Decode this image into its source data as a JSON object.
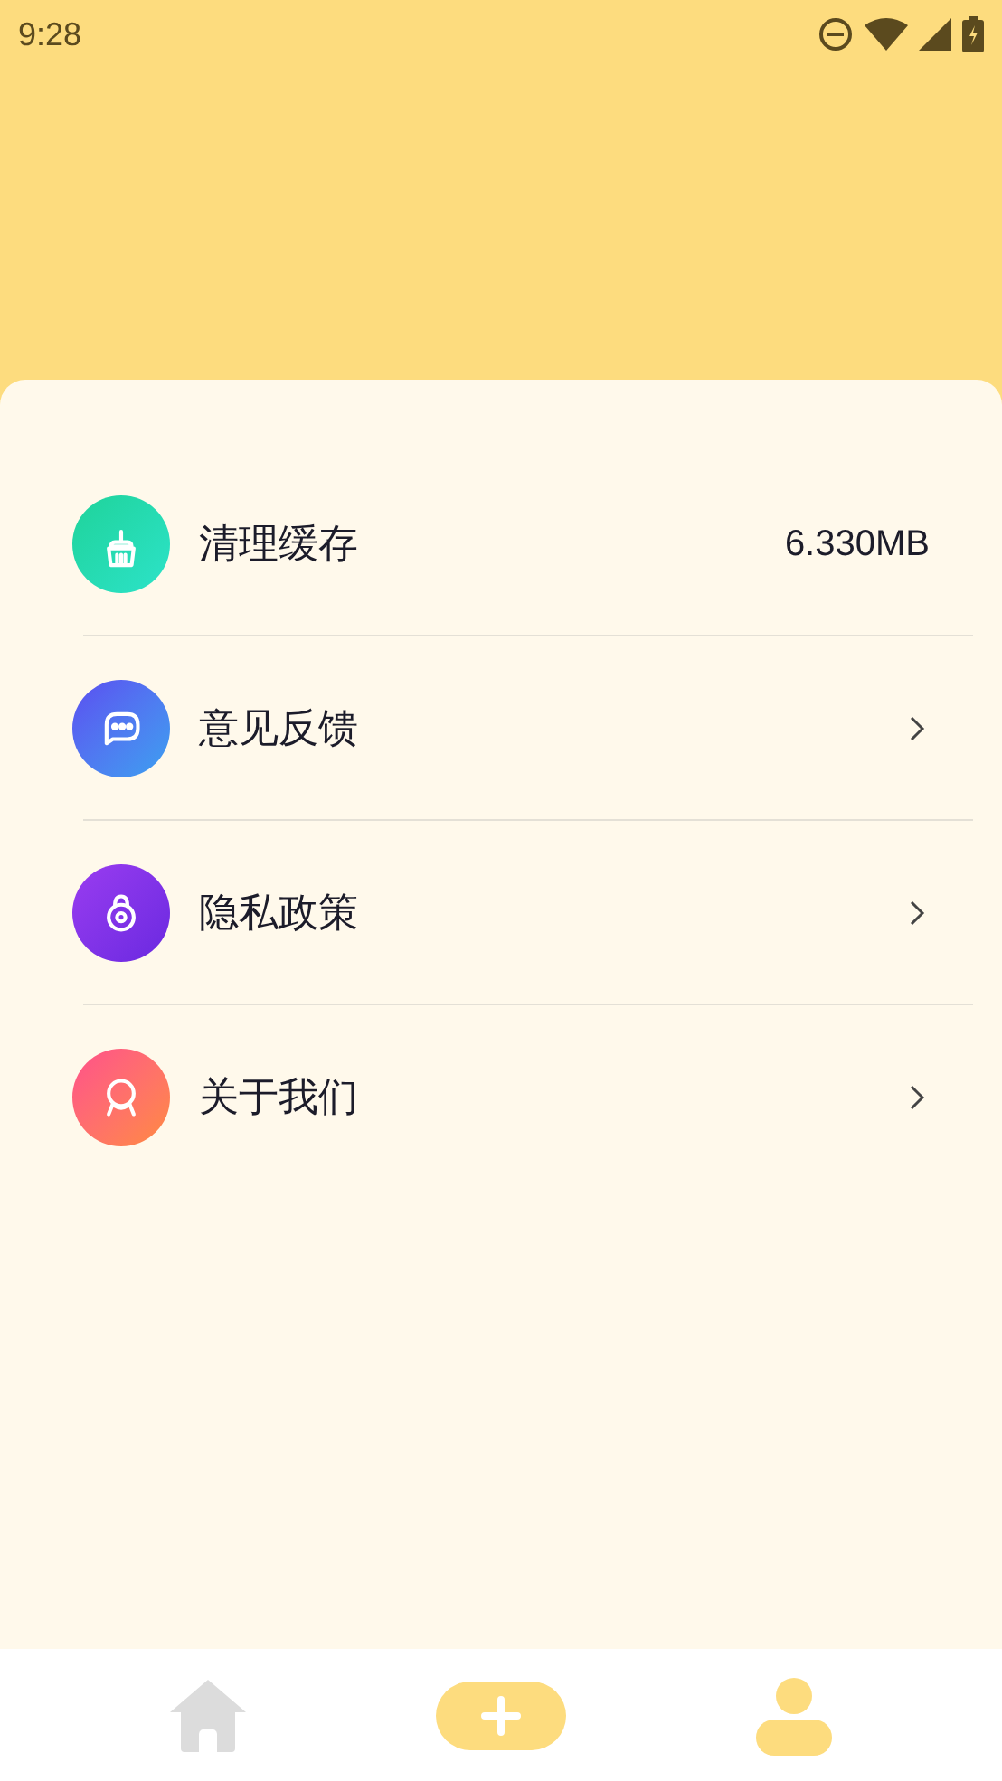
{
  "status_bar": {
    "time": "9:28"
  },
  "settings": [
    {
      "kind": "value",
      "label": "清理缓存",
      "value": "6.330MB"
    },
    {
      "kind": "link",
      "label": "意见反馈"
    },
    {
      "kind": "link",
      "label": "隐私政策"
    },
    {
      "kind": "link",
      "label": "关于我们"
    }
  ],
  "bottom_nav": [
    {
      "kind": "tab",
      "selected": false
    },
    {
      "kind": "add"
    },
    {
      "kind": "tab",
      "selected": true
    }
  ]
}
